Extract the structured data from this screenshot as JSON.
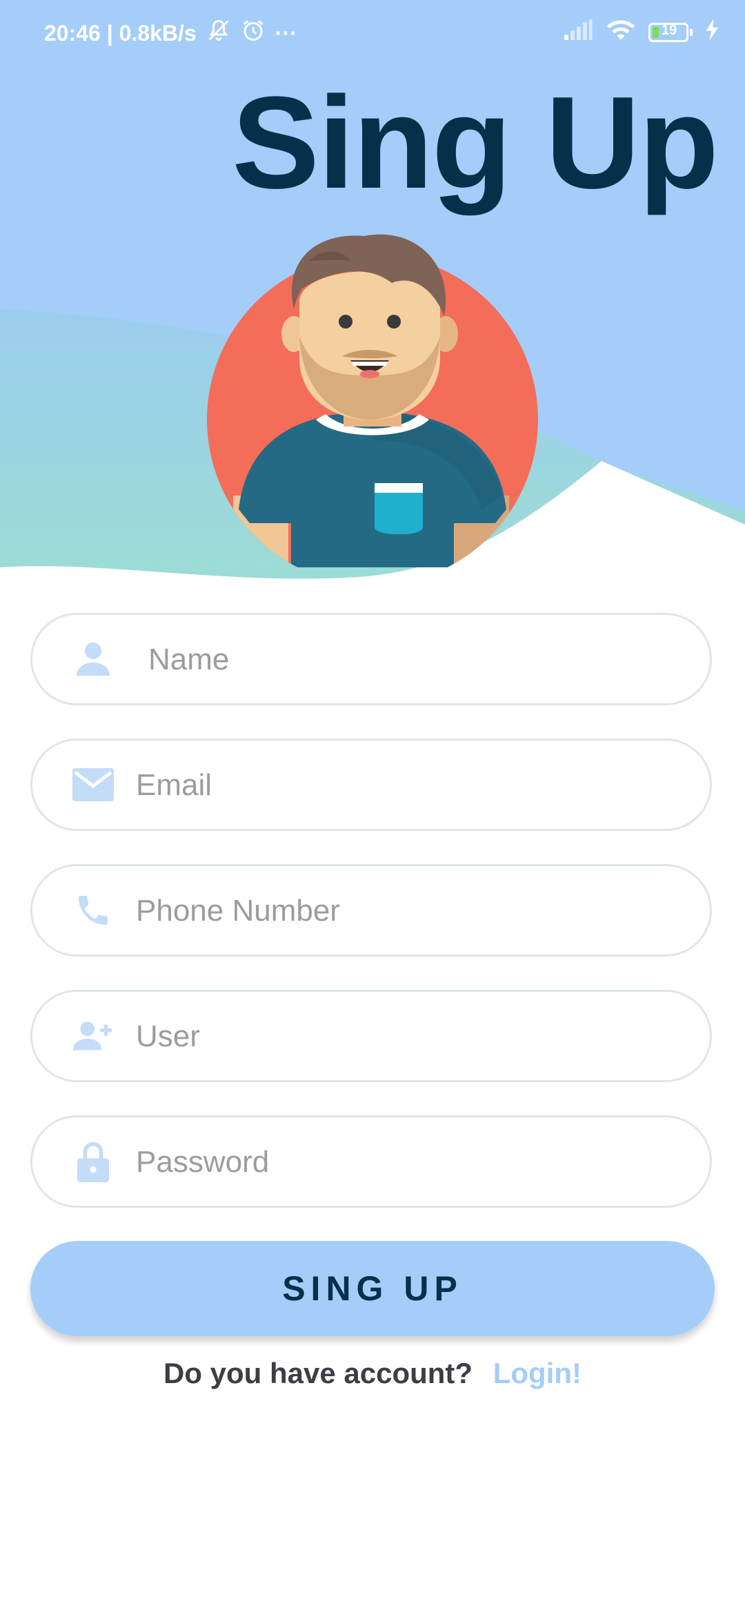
{
  "status_bar": {
    "time_speed": "20:46 | 0.8kB/s",
    "more": "···",
    "battery": "19",
    "icons": [
      "mute-icon",
      "alarm-icon",
      "signal-icon",
      "wifi-icon",
      "battery-icon",
      "charging-icon"
    ]
  },
  "header": {
    "title": "Sing Up"
  },
  "form": {
    "name_placeholder": "Name",
    "email_placeholder": "Email",
    "phone_placeholder": "Phone Number",
    "user_placeholder": "User",
    "password_placeholder": "Password"
  },
  "actions": {
    "signup_label": "SING UP",
    "account_prompt": "Do you have account?",
    "login_label": "Login!"
  },
  "colors": {
    "sky": "#a4cdfa",
    "hill": "#9cdbd6",
    "title": "#06304a",
    "icon": "#c3dcf8",
    "avatar_bg": "#f46d59"
  }
}
